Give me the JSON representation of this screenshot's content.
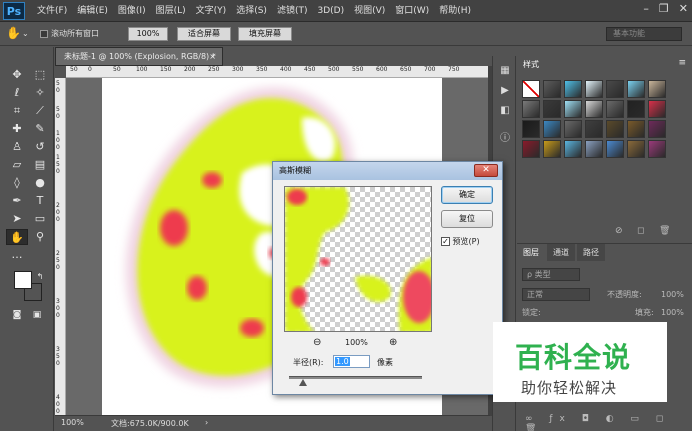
{
  "app": {
    "logo": "Ps"
  },
  "menu": [
    "文件(F)",
    "编辑(E)",
    "图像(I)",
    "图层(L)",
    "文字(Y)",
    "选择(S)",
    "滤镜(T)",
    "3D(D)",
    "视图(V)",
    "窗口(W)",
    "帮助(H)"
  ],
  "window_controls": {
    "minimize": "–",
    "restore": "❐",
    "close": "✕"
  },
  "options": {
    "scroll_all": "滚动所有窗口",
    "zoom_value": "100%",
    "fit_screen": "适合屏幕",
    "fill_screen": "填充屏幕",
    "workspace": "基本功能"
  },
  "document": {
    "tab_title": "未标题-1 @ 100% (Explosion, RGB/8) *",
    "tab_close": "×",
    "ruler_h": [
      "50",
      "0",
      "50",
      "100",
      "150",
      "200",
      "250",
      "300",
      "350",
      "400",
      "450",
      "500",
      "550",
      "600",
      "650",
      "700",
      "750"
    ],
    "ruler_v": [
      "5",
      "0",
      "5",
      "0",
      "1",
      "0",
      "0",
      "1",
      "5",
      "0",
      "2",
      "0",
      "0",
      "2",
      "5",
      "0",
      "3",
      "0",
      "0",
      "3",
      "5",
      "0",
      "4",
      "0",
      "0"
    ]
  },
  "status": {
    "zoom": "100%",
    "doc_size": "文档:675.0K/900.0K"
  },
  "styles_panel": {
    "tab": "样式",
    "swatch_colors": [
      "#ffffff",
      "#5d5d5d",
      "#4fc0e8",
      "#e3f4fb",
      "#4a4a4a",
      "#7ad1f0",
      "#c9b59a",
      "#7a7a7a",
      "#3a3a3a",
      "#9fe0f5",
      "#d8d8d8",
      "#6b6b6b",
      "#222222",
      "#d7304a",
      "#1a1a1a",
      "#3b88c3",
      "#6a6a6a",
      "#3f3f3f",
      "#5a4a2a",
      "#7a5a2a",
      "#6e2a5a",
      "#8a1a2a",
      "#c79a1a",
      "#5ab5e0",
      "#8aa0c0",
      "#4b8ad0",
      "#8a6a3a",
      "#9a3a7a"
    ]
  },
  "layers_panel": {
    "tabs": [
      "图层",
      "通道",
      "路径"
    ],
    "kind_filter": "ρ 类型",
    "blend_mode": "正常",
    "opacity_label": "不透明度:",
    "opacity_value": "100%",
    "lock_label": "锁定:",
    "fill_label": "填充:",
    "fill_value": "100%"
  },
  "gaussian_blur": {
    "title": "高斯模糊",
    "ok": "确定",
    "reset": "复位",
    "preview_label": "预览(P)",
    "preview_checked": true,
    "zoom_level": "100%",
    "radius_label": "半径(R):",
    "radius_value": "1.0",
    "unit": "像素"
  },
  "watermark": {
    "title": "百科全说",
    "subtitle": "助你轻松解决"
  }
}
